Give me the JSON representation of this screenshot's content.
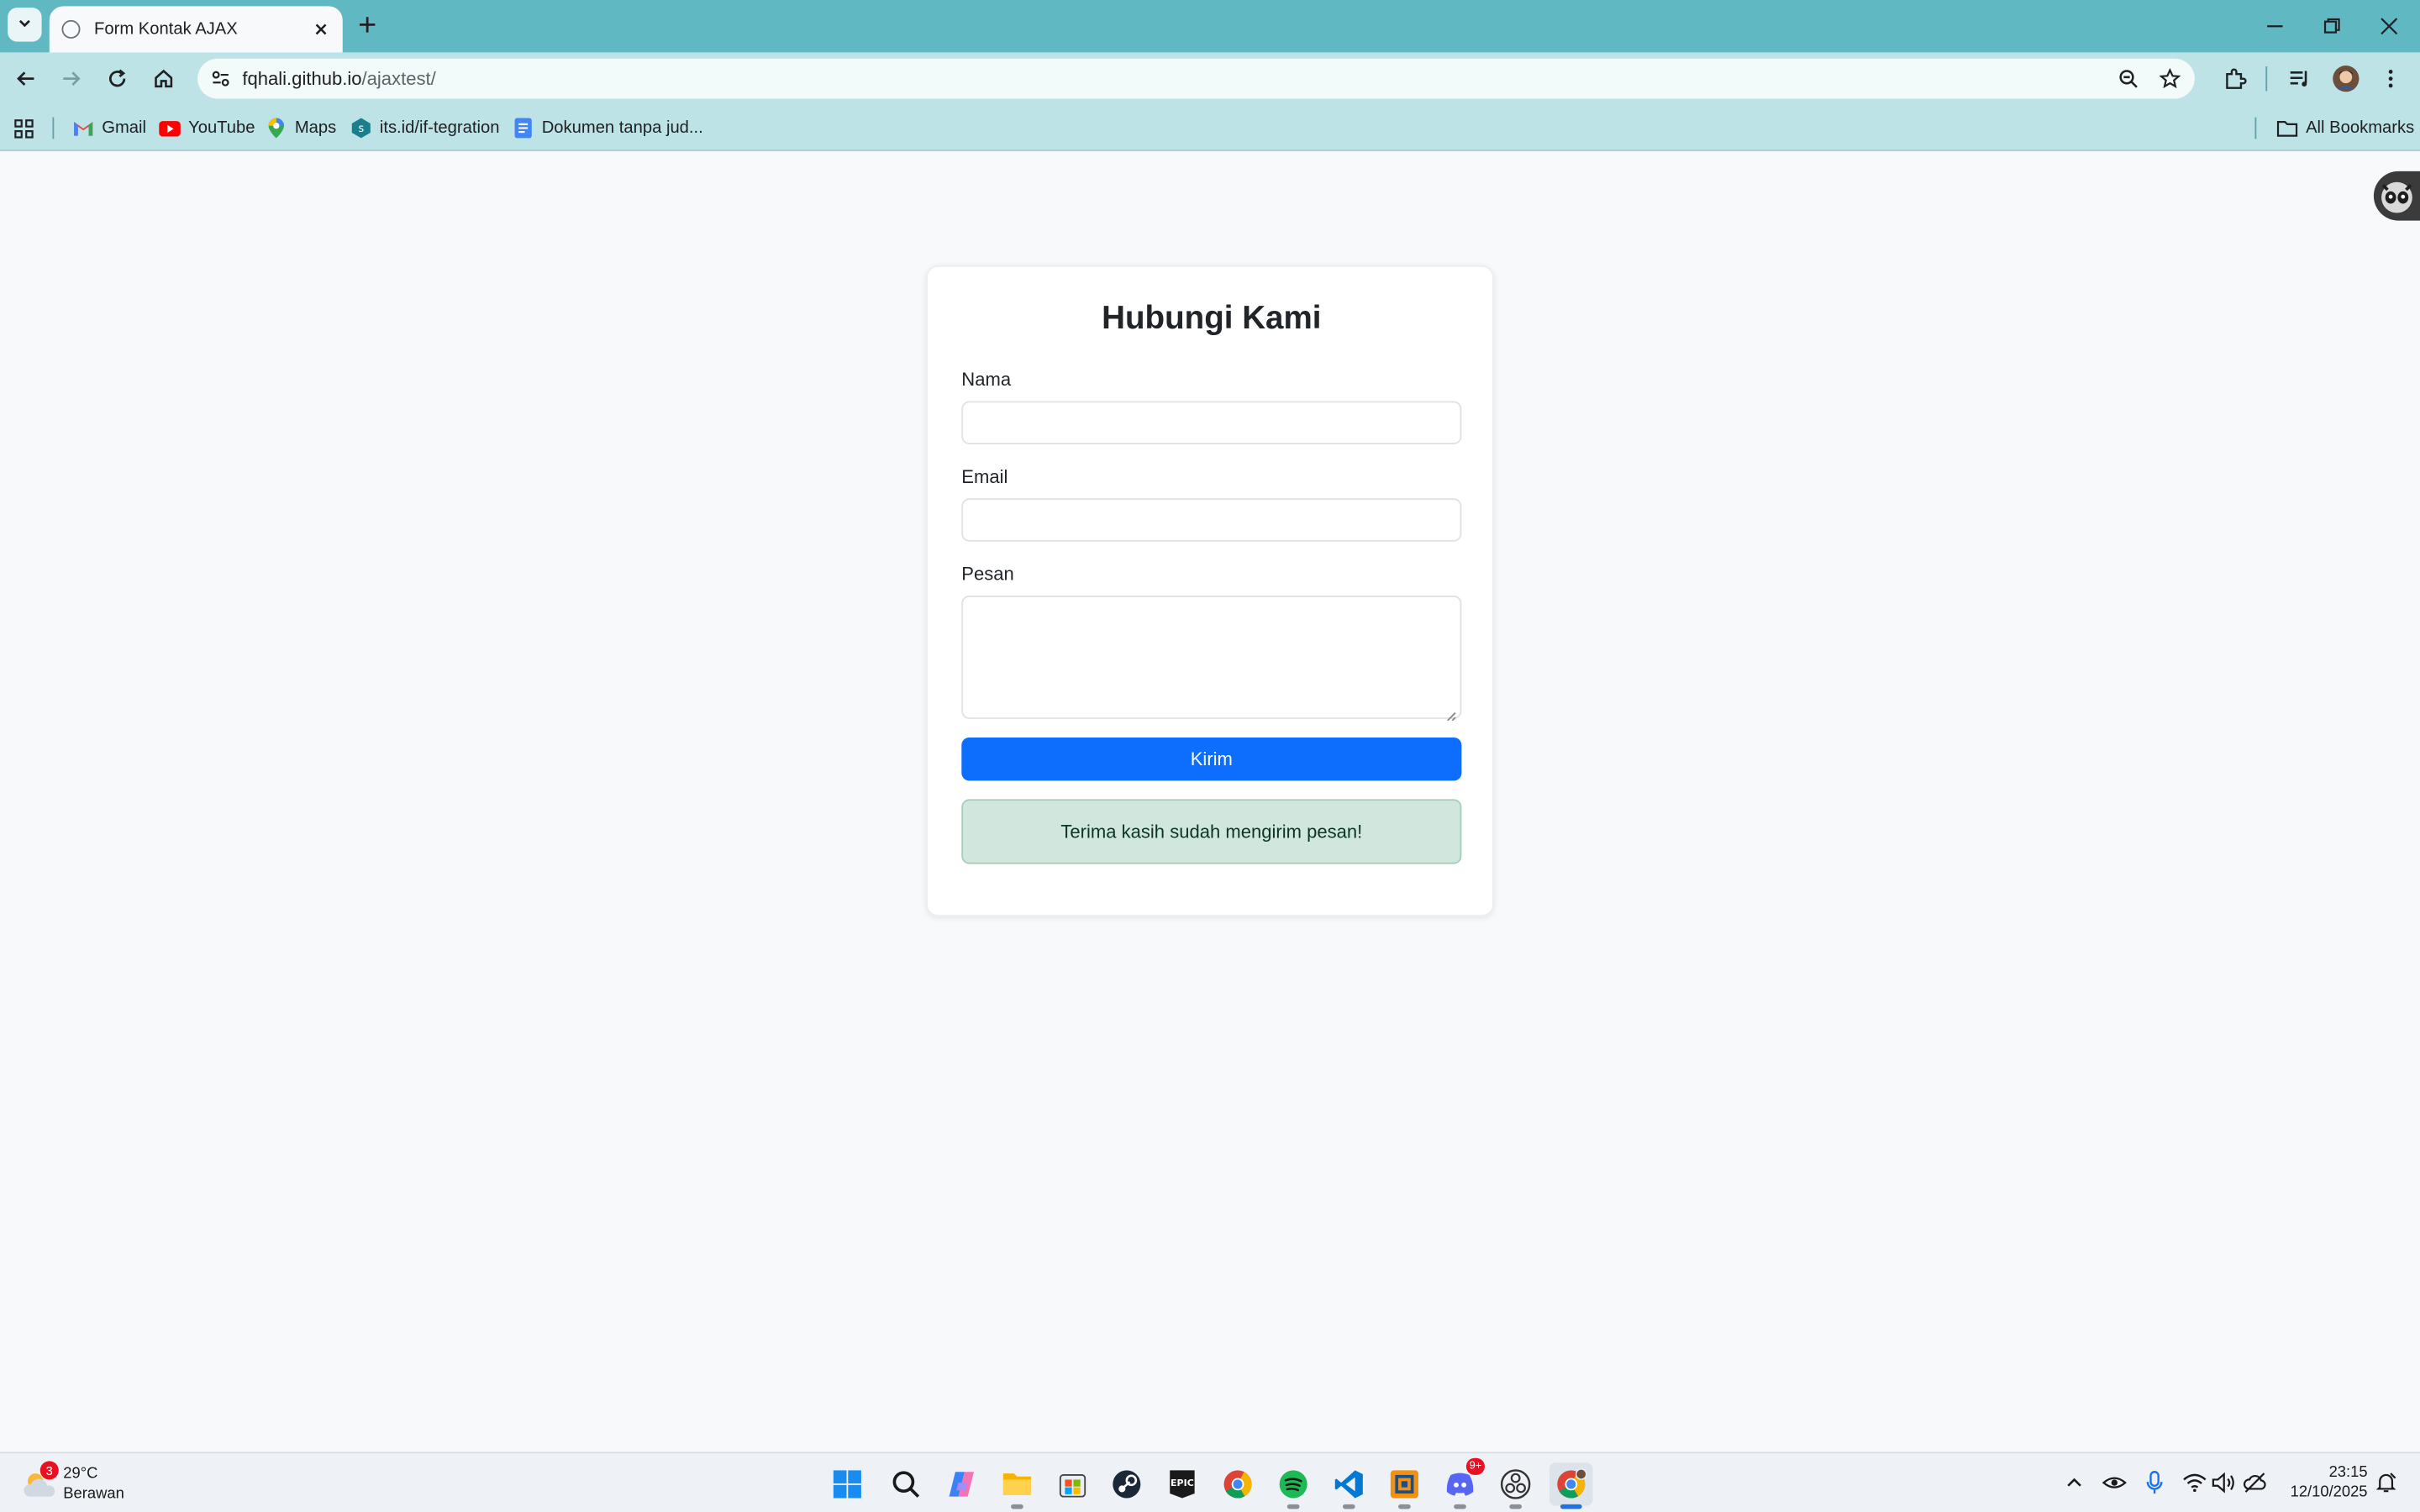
{
  "browser": {
    "tab_title": "Form Kontak AJAX",
    "url_host": "fqhali.github.io",
    "url_path": "/ajaxtest/"
  },
  "bookmarks": {
    "items": [
      "Gmail",
      "YouTube",
      "Maps",
      "its.id/if-tegration",
      "Dokumen tanpa jud..."
    ],
    "all_label": "All Bookmarks"
  },
  "form": {
    "title": "Hubungi Kami",
    "name_label": "Nama",
    "name_value": "",
    "email_label": "Email",
    "email_value": "",
    "message_label": "Pesan",
    "message_value": "",
    "submit_label": "Kirim",
    "success_message": "Terima kasih sudah mengirim pesan!"
  },
  "taskbar": {
    "weather_temp": "29°C",
    "weather_desc": "Berawan",
    "weather_badge": "3",
    "discord_badge": "9+",
    "time": "23:15",
    "date": "12/10/2025"
  },
  "colors": {
    "titlebar": "#5fb8c2",
    "toolbar": "#bde3e7",
    "primary_button": "#0d6efd",
    "success_bg": "#d1e7dd",
    "success_text": "#0a3622"
  }
}
